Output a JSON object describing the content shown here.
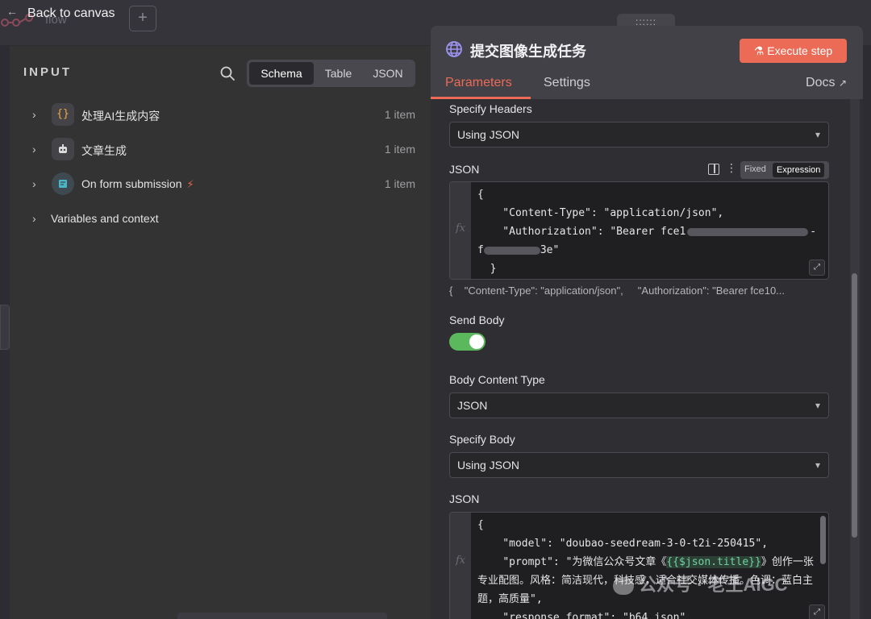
{
  "topbar": {
    "back_label": "Back to canvas",
    "ghost_workflow_name": "flow",
    "add_label": "+",
    "drag_handle": "::::::"
  },
  "input_panel": {
    "title": "INPUT",
    "view_options": [
      "Schema",
      "Table",
      "JSON"
    ],
    "active_view": "Schema",
    "nodes": [
      {
        "label": "处理AI生成内容",
        "count": "1 item",
        "icon": "json-braces-icon"
      },
      {
        "label": "文章生成",
        "count": "1 item",
        "icon": "robot-icon"
      },
      {
        "label": "On form submission",
        "count": "1 item",
        "icon": "form-icon",
        "trigger": true
      }
    ],
    "variables_label": "Variables and context"
  },
  "node_panel": {
    "title": "提交图像生成任务",
    "execute_label": "Execute step",
    "tabs": {
      "parameters": "Parameters",
      "settings": "Settings",
      "docs": "Docs"
    },
    "specify_headers_label": "Specify Headers",
    "specify_headers_value": "Using JSON",
    "json_label": "JSON",
    "fixed_label": "Fixed",
    "expression_label": "Expression",
    "fx_label": "fx",
    "headers_code": {
      "line1": "{",
      "line2": "    \"Content-Type\": \"application/json\",",
      "line3a": "    \"Authorization\": \"Bearer fce1",
      "line3b": "-",
      "line4a": "f",
      "line4b": "3e\"",
      "line5": "  }"
    },
    "headers_preview": "{    \"Content-Type\": \"application/json\",     \"Authorization\": \"Bearer fce10...",
    "send_body_label": "Send Body",
    "send_body_enabled": true,
    "body_content_type_label": "Body Content Type",
    "body_content_type_value": "JSON",
    "specify_body_label": "Specify Body",
    "specify_body_value": "Using JSON",
    "body_json_label": "JSON",
    "body_code": {
      "line1": "{",
      "line2": "    \"model\": \"doubao-seedream-3-0-t2i-250415\",",
      "line3a": "    \"prompt\": \"为微信公众号文章《",
      "line3expr": "{{$json.title}}",
      "line3b": "》创作一张专业配图。风格：简洁现代，科技感，适合社交媒体传播。色调：蓝白主题，高质量\",",
      "line4": "    \"response_format\": \"b64_json\","
    }
  },
  "watermark": "公众号 · 老王AIGC",
  "colors": {
    "accent": "#ec6b56",
    "toggle_on": "#5cb85c",
    "expression": "#6fd3a1"
  }
}
